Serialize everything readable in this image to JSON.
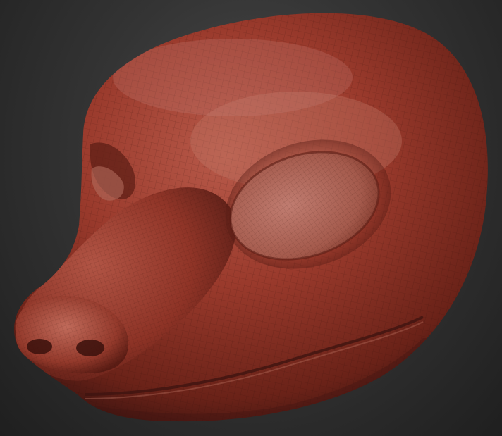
{
  "viewport": {
    "background_top": "#4a4a4a",
    "background_bottom": "#1f1f1f"
  },
  "model": {
    "material_color": "#9a3a2c",
    "highlight_color": "#c8786a",
    "shadow_color": "#3e1410",
    "wireframe": true
  }
}
